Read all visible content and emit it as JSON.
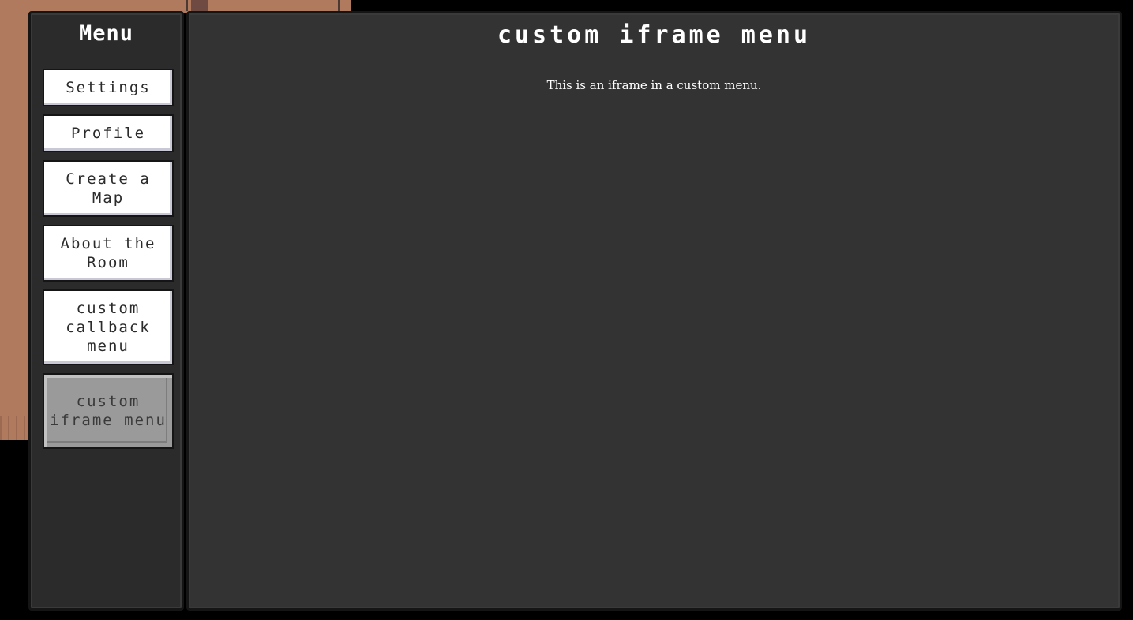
{
  "menu": {
    "title": "Menu",
    "items": [
      {
        "label": "Settings",
        "active": false
      },
      {
        "label": "Profile",
        "active": false
      },
      {
        "label": "Create a Map",
        "active": false
      },
      {
        "label": "About the Room",
        "active": false
      },
      {
        "label": "custom callback menu",
        "active": false
      },
      {
        "label": "custom iframe menu",
        "active": true
      }
    ]
  },
  "main": {
    "title": "custom iframe menu",
    "iframe_text": "This is an iframe in a custom menu."
  },
  "colors": {
    "background": "#000000",
    "map_ground": "#b07a5e",
    "panel": "#333333",
    "sidebar": "#2b2b2b",
    "button": "#ffffff",
    "button_active": "#9a9a9a"
  }
}
